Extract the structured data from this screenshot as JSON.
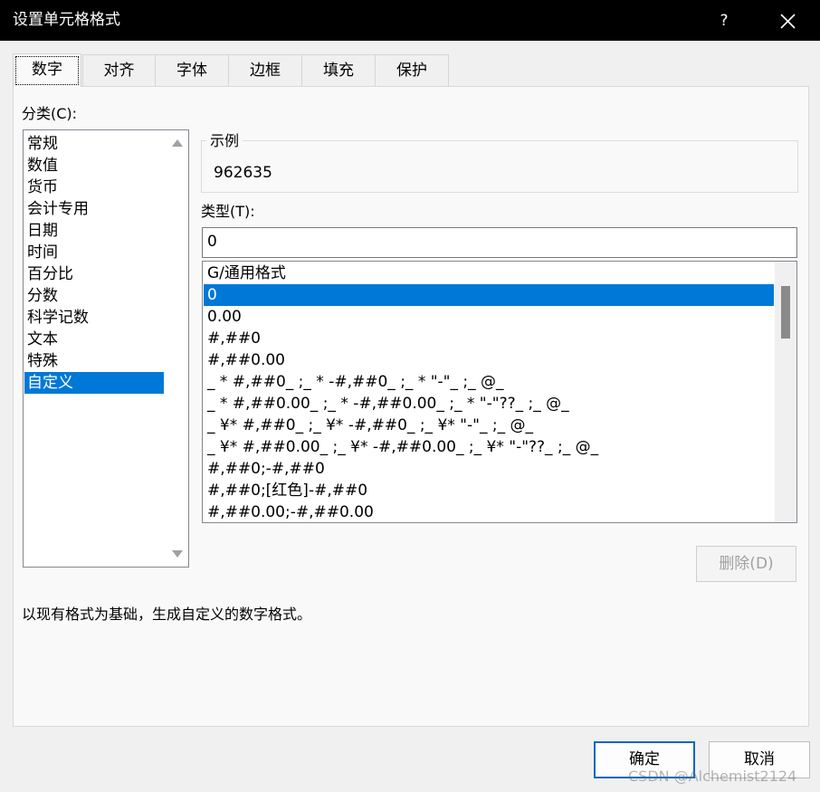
{
  "window": {
    "title": "设置单元格格式",
    "help_label": "?"
  },
  "tabs": [
    {
      "label": "数字",
      "active": true
    },
    {
      "label": "对齐",
      "active": false
    },
    {
      "label": "字体",
      "active": false
    },
    {
      "label": "边框",
      "active": false
    },
    {
      "label": "填充",
      "active": false
    },
    {
      "label": "保护",
      "active": false
    }
  ],
  "category": {
    "label": "分类(C):",
    "items": [
      "常规",
      "数值",
      "货币",
      "会计专用",
      "日期",
      "时间",
      "百分比",
      "分数",
      "科学记数",
      "文本",
      "特殊",
      "自定义"
    ],
    "selected": "自定义"
  },
  "sample": {
    "title": "示例",
    "value": "962635"
  },
  "type": {
    "label": "类型(T):",
    "value": "0"
  },
  "formats": {
    "items": [
      "G/通用格式",
      "0",
      "0.00",
      "#,##0",
      "#,##0.00",
      "_ * #,##0_ ;_ * -#,##0_ ;_ * \"-\"_ ;_ @_",
      "_ * #,##0.00_ ;_ * -#,##0.00_ ;_ * \"-\"??_ ;_ @_",
      "_ ¥* #,##0_ ;_ ¥* -#,##0_ ;_ ¥* \"-\"_ ;_ @_",
      "_ ¥* #,##0.00_ ;_ ¥* -#,##0.00_ ;_ ¥* \"-\"??_ ;_ @_",
      "#,##0;-#,##0",
      "#,##0;[红色]-#,##0",
      "#,##0.00;-#,##0.00"
    ],
    "selected": "0"
  },
  "delete_label": "删除(D)",
  "description": "以现有格式为基础，生成自定义的数字格式。",
  "ok_label": "确定",
  "cancel_label": "取消",
  "watermark": "CSDN @Alchemist2124",
  "colors": {
    "selection": "#0078d7",
    "titlebar": "#000000",
    "ok_border": "#0067c0"
  }
}
